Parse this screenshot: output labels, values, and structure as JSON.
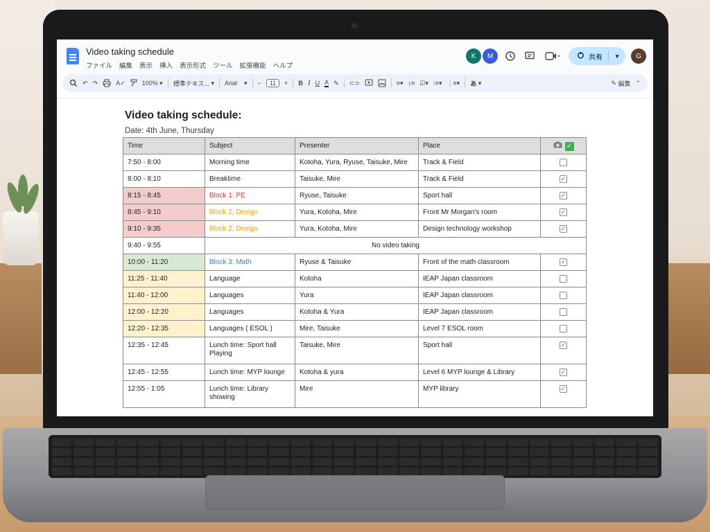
{
  "document": {
    "title": "Video taking schedule",
    "menu": [
      "ファイル",
      "編集",
      "表示",
      "挿入",
      "表示形式",
      "ツール",
      "拡張機能",
      "ヘルプ"
    ],
    "collaborators": [
      {
        "initial": "K",
        "color": "#0f766e"
      },
      {
        "initial": "M",
        "color": "#3b5bdb"
      }
    ],
    "share_label": "共有",
    "user_initial": "G",
    "user_color": "#5a3a2b"
  },
  "toolbar": {
    "zoom": "100%",
    "style": "標準テキス...",
    "font": "Arial",
    "font_size": "11",
    "ime": "あ",
    "edit_mode": "編集"
  },
  "page": {
    "heading": "Video taking schedule:",
    "date": "Date: 4th June, Thursday"
  },
  "table": {
    "headers": {
      "time": "Time",
      "subject": "Subject",
      "presenter": "Presenter",
      "place": "Place"
    },
    "rows": [
      {
        "time": "7:50 - 8:00",
        "subject": "Morning time",
        "presenter": "Kotoha, Yura, Ryuse, Taisuke, Mire",
        "place": "Track & Field",
        "checked": false,
        "time_bg": "",
        "subject_color": ""
      },
      {
        "time": "8:00 - 8:10",
        "subject": "Breaktime",
        "presenter": "Taisuke, Mire",
        "place": "Track & Field",
        "checked": true,
        "time_bg": "",
        "subject_color": ""
      },
      {
        "time": "8:15 - 8:45",
        "subject": "Block 1: PE",
        "presenter": "Ryuse, Taisuke",
        "place": "Sport hall",
        "checked": true,
        "time_bg": "#f4cccc",
        "subject_color": "#e03131"
      },
      {
        "time": "8:45 - 9:10",
        "subject": "Block 2: Design",
        "presenter": "Yura, Kotoha, Mire",
        "place": "Front Mr Morgan's room",
        "checked": true,
        "time_bg": "#f4cccc",
        "subject_color": "#f59f00"
      },
      {
        "time": "9:10 - 9:35",
        "subject": "Block 2: Design",
        "presenter": "Yura, Kotoha, Mire",
        "place": "Design technology workshop",
        "checked": true,
        "time_bg": "#f4cccc",
        "subject_color": "#f59f00"
      },
      {
        "time": "9:40 - 9:55",
        "merged": "No video taking",
        "time_bg": ""
      },
      {
        "time": "10:00 - 11:20",
        "subject": "Block 3: Math",
        "presenter": "Ryuse & Taisuke",
        "place": "Front of the math classroom",
        "checked": true,
        "time_bg": "#d9ead3",
        "subject_color": "#3a7bd5"
      },
      {
        "time": "11:25 - 11:40",
        "subject": "Language",
        "presenter": "Kotoha",
        "place": "IEAP Japan classroom",
        "checked": false,
        "time_bg": "#fff2cc",
        "subject_color": ""
      },
      {
        "time": "11:40 - 12:00",
        "subject": "Languages",
        "presenter": "Yura",
        "place": "IEAP Japan classroom",
        "checked": false,
        "time_bg": "#fff2cc",
        "subject_color": ""
      },
      {
        "time": "12:00 - 12:20",
        "subject": "Languages",
        "presenter": "Kotoha & Yura",
        "place": "IEAP Japan classroom",
        "checked": false,
        "time_bg": "#fff2cc",
        "subject_color": ""
      },
      {
        "time": "12:20 - 12:35",
        "subject": "Languages ( ESOL )",
        "presenter": "Mire, Taisuke",
        "place": "Level 7 ESOL room",
        "checked": false,
        "time_bg": "#fff2cc",
        "subject_color": ""
      },
      {
        "time": "12:35 - 12:45",
        "subject": "Lunch time: Sport hall Playing",
        "presenter": "Taisuke, Mire",
        "place": "Sport hall",
        "checked": true,
        "time_bg": "",
        "subject_color": "",
        "tall": true
      },
      {
        "time": "12:45 - 12:55",
        "subject": "Lunch time: MYP lounge",
        "presenter": "Kotoha & yura",
        "place": "Level 6 MYP lounge & Library",
        "checked": true,
        "time_bg": "",
        "subject_color": ""
      },
      {
        "time": "12:55 - 1:05",
        "subject": "Lunch time: Library showing",
        "presenter": "Mire",
        "place": "MYP library",
        "checked": true,
        "time_bg": "",
        "subject_color": "",
        "tall": true
      }
    ]
  }
}
